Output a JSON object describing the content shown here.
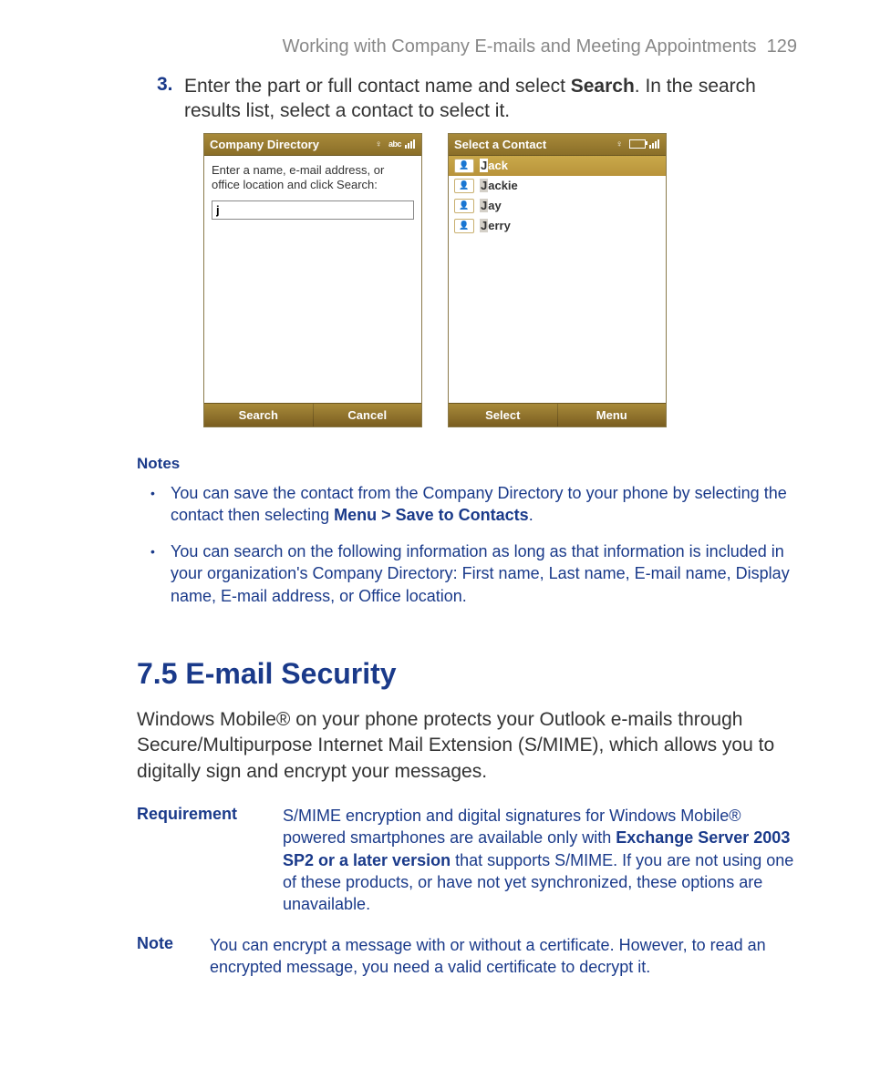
{
  "header": {
    "title": "Working with Company E-mails and Meeting Appointments",
    "page": "129"
  },
  "step": {
    "num": "3.",
    "text_before": "Enter the part or full contact name and select ",
    "text_bold": "Search",
    "text_after": ". In the search results list, select a contact to select it."
  },
  "phone1": {
    "title": "Company Directory",
    "input_mode": "abc",
    "prompt": "Enter a name, e-mail address, or office location and click Search:",
    "input_value": "j",
    "softkey_left": "Search",
    "softkey_right": "Cancel"
  },
  "phone2": {
    "title": "Select a Contact",
    "contacts": [
      {
        "match": "J",
        "rest": "ack",
        "selected": true
      },
      {
        "match": "J",
        "rest": "ackie",
        "selected": false
      },
      {
        "match": "J",
        "rest": "ay",
        "selected": false
      },
      {
        "match": "J",
        "rest": "erry",
        "selected": false
      }
    ],
    "softkey_left": "Select",
    "softkey_right": "Menu"
  },
  "notes": {
    "label": "Notes",
    "items": [
      {
        "pre": "You can save the contact from the Company Directory to your phone by selecting the contact then selecting ",
        "bold": "Menu > Save to Contacts",
        "post": "."
      },
      {
        "pre": "You can search on the following information as long as that information is included in your organization's Company Directory: First name, Last name, E-mail name, Display name, E-mail address, or Office location.",
        "bold": "",
        "post": ""
      }
    ]
  },
  "section": {
    "heading": "7.5  E-mail Security",
    "para": "Windows Mobile® on your phone protects your Outlook e-mails through Secure/Multipurpose Internet Mail Extension (S/MIME), which allows you to digitally sign and encrypt your messages."
  },
  "requirement": {
    "label": "Requirement",
    "pre": "S/MIME encryption and digital signatures for Windows Mobile® powered smartphones are available only with ",
    "bold": "Exchange Server 2003 SP2 or a later version",
    "post": " that supports S/MIME. If you are not using one of these products, or have not yet synchronized, these options are unavailable."
  },
  "note2": {
    "label": "Note",
    "text": "You can encrypt a message with or without a certificate. However, to read an encrypted message, you need a valid certificate to decrypt it."
  }
}
